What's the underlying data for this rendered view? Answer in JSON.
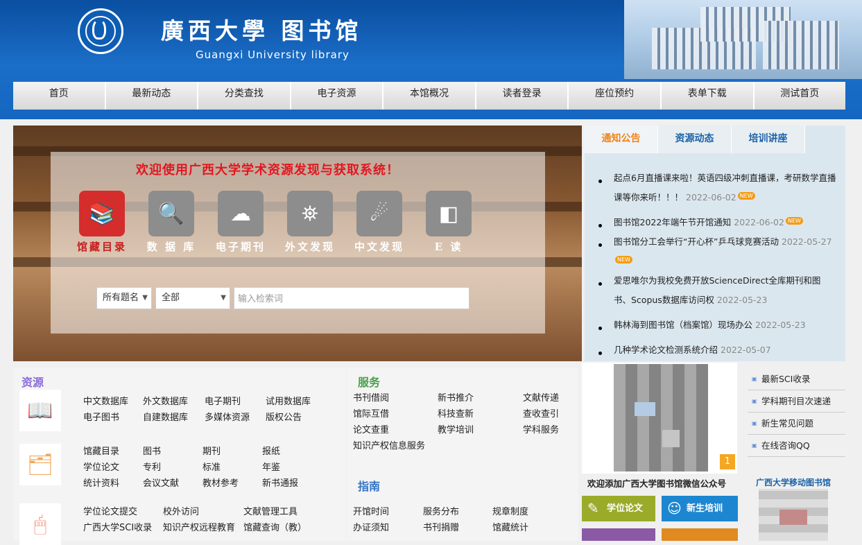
{
  "header": {
    "title_cn": "廣西大學 图书馆",
    "title_en": "Guangxi University library"
  },
  "nav": {
    "items": [
      "首页",
      "最新动态",
      "分类查找",
      "电子资源",
      "本馆概况",
      "读者登录",
      "座位预约",
      "表单下载",
      "测试首页"
    ]
  },
  "banner": {
    "welcome": "欢迎使用广西大学学术资源发现与获取系统！",
    "tiles": [
      {
        "label": "馆藏目录",
        "icon": "books-pen-icon",
        "color": "#d52c2c"
      },
      {
        "label": "数 据 库",
        "icon": "search-document-icon",
        "color": "#8d8d8d"
      },
      {
        "label": "电子期刊",
        "icon": "cloud-monitor-icon",
        "color": "#8d8d8d"
      },
      {
        "label": "外文发现",
        "icon": "binoculars-icon",
        "color": "#8d8d8d"
      },
      {
        "label": "中文发现",
        "icon": "comet-icon",
        "color": "#8d8d8d"
      },
      {
        "label": "E 读",
        "icon": "e-read-icon",
        "color": "#8d8d8d"
      }
    ],
    "search": {
      "field_select": "所有题名",
      "scope_select": "全部",
      "placeholder": "输入检索词"
    }
  },
  "news": {
    "tabs": [
      "通知公告",
      "资源动态",
      "培训讲座"
    ],
    "active_tab": "通知公告",
    "items": [
      {
        "text": "起点6月直播课来啦！英语四级冲刺直播课，考研数学直播课等你来听！！！",
        "date": "2022-06-02",
        "new": "NEW"
      },
      {
        "text": "图书馆2022年端午节开馆通知",
        "date": "2022-06-02",
        "new": "NEW"
      },
      {
        "text": "图书馆分工会举行“开心杯”乒乓球竞赛活动",
        "date": "2022-05-27",
        "new": "NEW"
      },
      {
        "text": "爱思唯尔为我校免费开放ScienceDirect全库期刊和图书、Scopus数据库访问权",
        "date": "2022-05-23",
        "new": ""
      },
      {
        "text": "韩林海到图书馆（档案馆）现场办公",
        "date": "2022-05-23",
        "new": ""
      },
      {
        "text": "几种学术论文检测系统介绍",
        "date": "2022-05-07",
        "new": ""
      }
    ]
  },
  "resources": {
    "title": "资源",
    "groups": [
      {
        "icon": "open-book-icon",
        "rows": [
          [
            "中文数据库",
            "外文数据库",
            "电子期刊",
            "试用数据库"
          ],
          [
            "电子图书",
            "自建数据库",
            "多媒体资源",
            "版权公告"
          ]
        ]
      },
      {
        "icon": "binders-icon",
        "rows": [
          [
            "馆藏目录",
            "图书",
            "期刊",
            "报纸"
          ],
          [
            "学位论文",
            "专利",
            "标准",
            "年鉴"
          ],
          [
            "统计资料",
            "会议文献",
            "教材参考",
            "新书通报"
          ]
        ]
      },
      {
        "icon": "mouse-icon",
        "rows": [
          [
            "学位论文提交",
            "校外访问",
            "文献管理工具"
          ],
          [
            "广西大学SCI收录",
            "知识产权远程教育",
            "馆藏查询（教）"
          ]
        ]
      }
    ]
  },
  "services": {
    "title": "服务",
    "cells": [
      [
        "书刊借阅",
        "新书推介",
        "文献传递"
      ],
      [
        "馆际互借",
        "科技查新",
        "查收查引"
      ],
      [
        "论文查重",
        "教学培训",
        "学科服务"
      ],
      [
        "知识产权信息服务",
        "",
        ""
      ]
    ],
    "guide_title": "指南",
    "guide_cells": [
      [
        "开馆时间",
        "服务分布",
        "规章制度"
      ],
      [
        "办证须知",
        "书刊捐赠",
        "馆藏统计"
      ]
    ]
  },
  "wechat": {
    "caption": "欢迎添加广西大学图书馆微信公众号",
    "badge": "1",
    "buttons": [
      {
        "label": "学位论文",
        "icon": "thesis-icon",
        "color": "#9aab2a"
      },
      {
        "label": "新生培训",
        "icon": "people-icon",
        "color": "#1d86d0"
      }
    ]
  },
  "quick_links": [
    "最新SCI收录",
    "学科期刊目次速递",
    "新生常见问题",
    "在线咨询QQ"
  ],
  "mobile": {
    "title": "广西大学移动图书馆"
  }
}
